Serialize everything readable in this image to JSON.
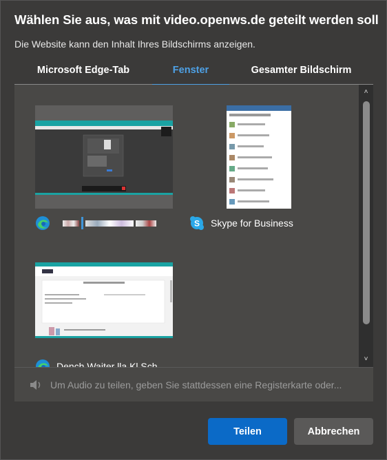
{
  "dialog": {
    "title": "Wählen Sie aus, was mit video.openws.de geteilt werden soll",
    "subtitle": "Die Website kann den Inhalt Ihres Bildschirms anzeigen."
  },
  "tabs": [
    {
      "label": "Microsoft Edge-Tab",
      "active": false
    },
    {
      "label": "Fenster",
      "active": true
    },
    {
      "label": "Gesamter Bildschirm",
      "active": false
    }
  ],
  "windows": [
    {
      "label": "",
      "icon": "edge-icon"
    },
    {
      "label": "Skype for Business",
      "icon": "skype-icon"
    },
    {
      "label": "Dench Waiter lla Kl Sch...",
      "icon": "edge-icon"
    }
  ],
  "audio": {
    "text": "Um Audio zu teilen, geben Sie stattdessen eine Registerkarte oder..."
  },
  "buttons": {
    "share": "Teilen",
    "cancel": "Abbrechen"
  },
  "colors": {
    "accent": "#4ea1e6",
    "primary_button": "#0b6ac7"
  }
}
